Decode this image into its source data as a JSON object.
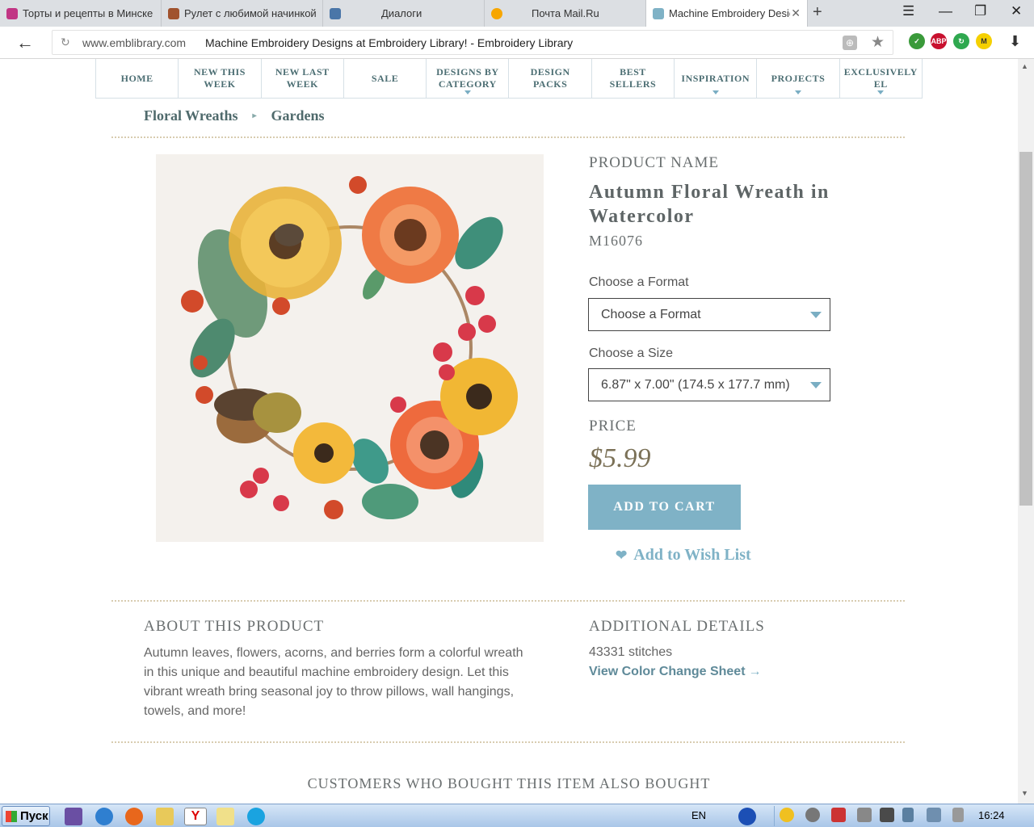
{
  "browser": {
    "tabs": [
      {
        "label": "Торты и рецепты в Минске",
        "icon": "instagram-icon",
        "color": "#c13584"
      },
      {
        "label": "Рулет с любимой начинкой",
        "icon": "recipe-site-icon",
        "color": "#a0522d"
      },
      {
        "label": "Диалоги",
        "icon": "vk-dialogs-icon",
        "color": "#4a76a8"
      },
      {
        "label": "Почта Mail.Ru",
        "icon": "mailru-icon",
        "color": "#f7a600"
      },
      {
        "label": "Machine Embroidery Designs at Embroidery Library! - Embroidery Library",
        "icon": "emblibrary-icon",
        "color": "#7fb2c6"
      }
    ],
    "new_tab": "+",
    "address": {
      "domain": "www.emblibrary.com",
      "title": "Machine Embroidery Designs at Embroidery Library! - Embroidery Library"
    },
    "extensions": [
      {
        "name": "shield-extension-icon",
        "badge": "1",
        "color": "#3a9a3a"
      },
      {
        "name": "adblock-plus-icon",
        "label": "ABP",
        "color": "#c8102e"
      },
      {
        "name": "green-extension-icon",
        "badge": "1",
        "color": "#2fa84f"
      },
      {
        "name": "mail-extension-icon",
        "label": "M",
        "color": "#f5d000"
      }
    ]
  },
  "nav": {
    "items": [
      {
        "label": "HOME",
        "caret": false
      },
      {
        "label": "NEW THIS WEEK",
        "caret": false
      },
      {
        "label": "NEW LAST WEEK",
        "caret": false
      },
      {
        "label": "SALE",
        "caret": false
      },
      {
        "label": "DESIGNS BY CATEGORY",
        "caret": true
      },
      {
        "label": "DESIGN PACKS",
        "caret": false
      },
      {
        "label": "BEST SELLERS",
        "caret": false
      },
      {
        "label": "INSPIRATION",
        "caret": true
      },
      {
        "label": "PROJECTS",
        "caret": true
      },
      {
        "label": "EXCLUSIVELY EL",
        "caret": true
      }
    ]
  },
  "breadcrumb": {
    "first": "Floral Wreaths",
    "second": "Gardens"
  },
  "product": {
    "name_label": "PRODUCT NAME",
    "name": "Autumn Floral Wreath in Watercolor",
    "sku": "M16076",
    "format_label": "Choose a Format",
    "format_value": "Choose a Format",
    "size_label": "Choose a Size",
    "size_value": "6.87\" x 7.00\" (174.5 x 177.7 mm)",
    "price_label": "PRICE",
    "price": "$5.99",
    "add_to_cart": "ADD TO CART",
    "wish_list": "Add to Wish List"
  },
  "about": {
    "heading": "ABOUT THIS PRODUCT",
    "text": "Autumn leaves, flowers, acorns, and berries form a colorful wreath in this unique and beautiful machine embroidery design. Let this vibrant wreath bring seasonal joy to throw pillows, wall hangings, towels, and more!"
  },
  "details": {
    "heading": "ADDITIONAL DETAILS",
    "stitches": "43331 stitches",
    "color_sheet": "View Color Change Sheet"
  },
  "also_bought": "CUSTOMERS WHO BOUGHT THIS ITEM ALSO BOUGHT",
  "taskbar": {
    "start": "Пуск",
    "lang": "EN",
    "clock": "16:24"
  },
  "colors": {
    "accent": "#7fb2c6",
    "nav_text": "#4c6e73",
    "price": "#7b7157"
  }
}
